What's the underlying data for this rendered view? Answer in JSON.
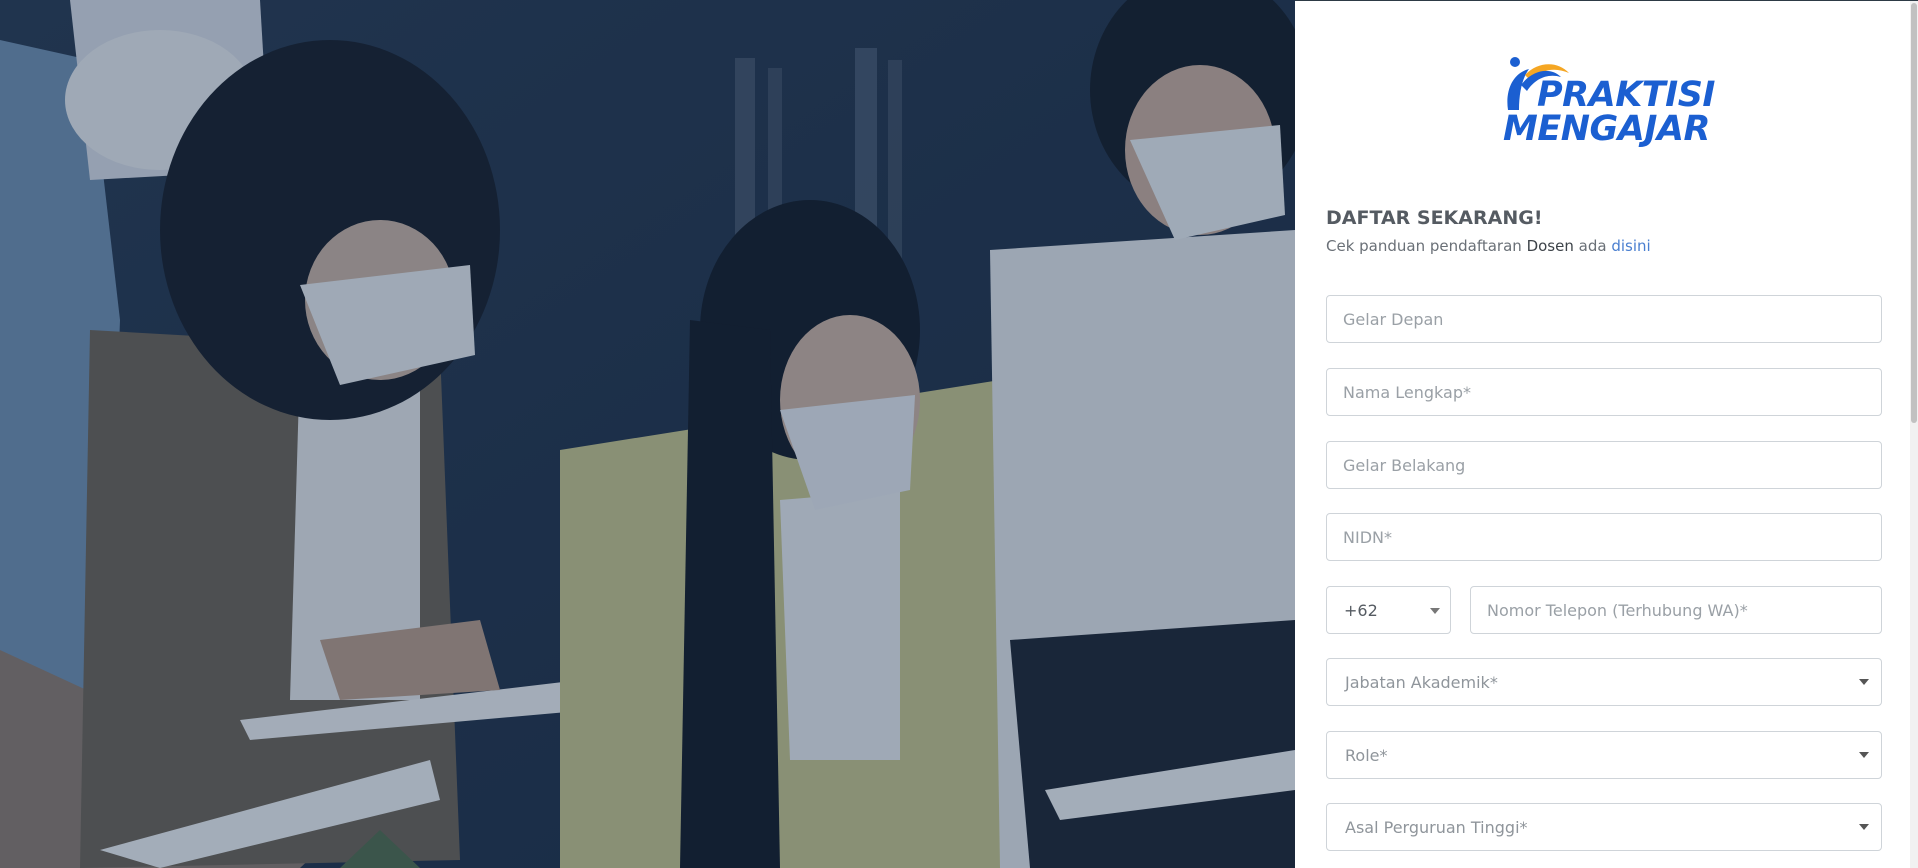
{
  "brand": {
    "line1": "PRAKTISI",
    "line2": "MENGAJAR",
    "color_primary": "#1b5fd1",
    "color_accent": "#f5a623"
  },
  "form": {
    "title": "DAFTAR SEKARANG!",
    "subtitle_prefix": "Cek panduan pendaftaran ",
    "subtitle_role": "Dosen",
    "subtitle_mid": " ada ",
    "subtitle_link": "disini",
    "fields": {
      "gelar_depan": "Gelar Depan",
      "nama_lengkap": "Nama Lengkap*",
      "gelar_belakang": "Gelar Belakang",
      "nidn": "NIDN*",
      "phone_code": "+62",
      "phone": "Nomor Telepon (Terhubung WA)*",
      "jabatan": "Jabatan Akademik*",
      "role": "Role*",
      "asal_pt": "Asal Perguruan Tinggi*"
    }
  },
  "icons": {
    "logo": "praktisi-mengajar-logo",
    "dropdown": "chevron-down-icon"
  }
}
